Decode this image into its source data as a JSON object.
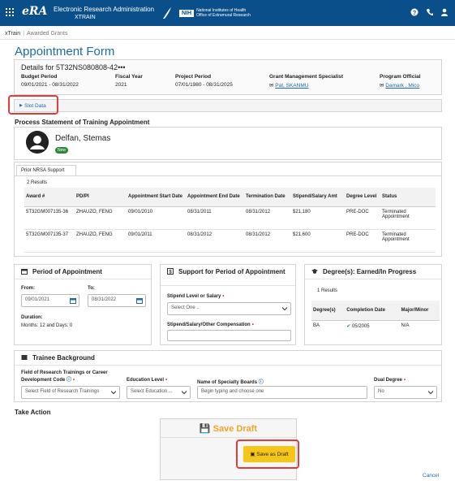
{
  "topbar": {
    "logo": "eRA",
    "app_name": "Electronic Research Administration",
    "module": "XTRAIN",
    "nih_badge": "NIH",
    "nih_line1": "National Institutes of Health",
    "nih_line2": "Office of Extramural Research"
  },
  "breadcrumb": {
    "app": "xTrain",
    "sub": "Awarded Grants"
  },
  "page_title": "Appointment Form",
  "details": {
    "heading": "Details for 5T32NS080808-42•••",
    "budget_period_label": "Budget Period",
    "budget_period": "09/01/2021 - 08/31/2022",
    "fiscal_year_label": "Fiscal Year",
    "fiscal_year": "2021",
    "project_period_label": "Project Period",
    "project_period": "07/01/1980 - 08/31/2025",
    "gms_label": "Grant Management Specialist",
    "gms": "Pat, SKANMU",
    "po_label": "Program Official",
    "po": "Damark , Mico"
  },
  "slot_data": "Slot Data",
  "process_heading": "Process Statement of Training Appointment",
  "trainee": {
    "name": "Delfan, Stemas",
    "badge": "New"
  },
  "history": {
    "tab": "Prior NRSA Support",
    "results": "2 Results",
    "headers": [
      "Award #",
      "PD/PI",
      "Appointment Start Date",
      "Appointment End Date",
      "Termination Date",
      "Stipend/Salary Amt",
      "Degree Level",
      "Status"
    ],
    "rows": [
      [
        "5T32GM007135-36",
        "ZHAUZO, FENG",
        "09/01/2010",
        "08/31/2011",
        "08/31/2012",
        "$21,180",
        "PRE-DOC",
        "Terminated Appointment"
      ],
      [
        "5T32GM007135-37",
        "ZHAUZO, FENG",
        "09/01/2011",
        "08/31/2012",
        "08/31/2012",
        "$21,600",
        "PRE-DOC",
        "Terminated Appointment"
      ]
    ]
  },
  "period": {
    "title": "Period of Appointment",
    "from_label": "From:",
    "from_value": "09/01/2021",
    "to_label": "To:",
    "to_value": "08/31/2022",
    "duration_label": "Duration:",
    "duration_value": "Months: 12 and Days: 0"
  },
  "support": {
    "title": "Support for Period of Appointment",
    "stipend_level_label": "Stipend Level or Salary",
    "stipend_level_placeholder": "Select One ..",
    "compensation_label": "Stipend/Salary/Other Compensation"
  },
  "degrees": {
    "title": "Degree(s): Earned/In Progress",
    "results": "1 Results",
    "headers": [
      "Degree(s)",
      "Completion Date",
      "Major/Minor"
    ],
    "rows": [
      [
        "BA",
        "05/2005",
        "N/A"
      ]
    ]
  },
  "background": {
    "title": "Trainee Background",
    "field_label": "Field of Research Trainings or Career Development Code",
    "field_placeholder": "Select Field of Research Trainings",
    "education_label": "Education Level",
    "education_placeholder": "Select Education ...",
    "boards_label": "Name of Specialty Boards",
    "boards_placeholder": "Begin typing and choose one",
    "dual_label": "Dual Degree",
    "dual_value": "No"
  },
  "actions": {
    "heading": "Take Action",
    "box_title": "Save Draft",
    "save_button": "Save as Draft",
    "cancel": "Cancel"
  },
  "colors": {
    "header": "#0a4f8a",
    "link": "#1f6aa6",
    "draft": "#f5c518",
    "highlight": "#e23b3b"
  }
}
